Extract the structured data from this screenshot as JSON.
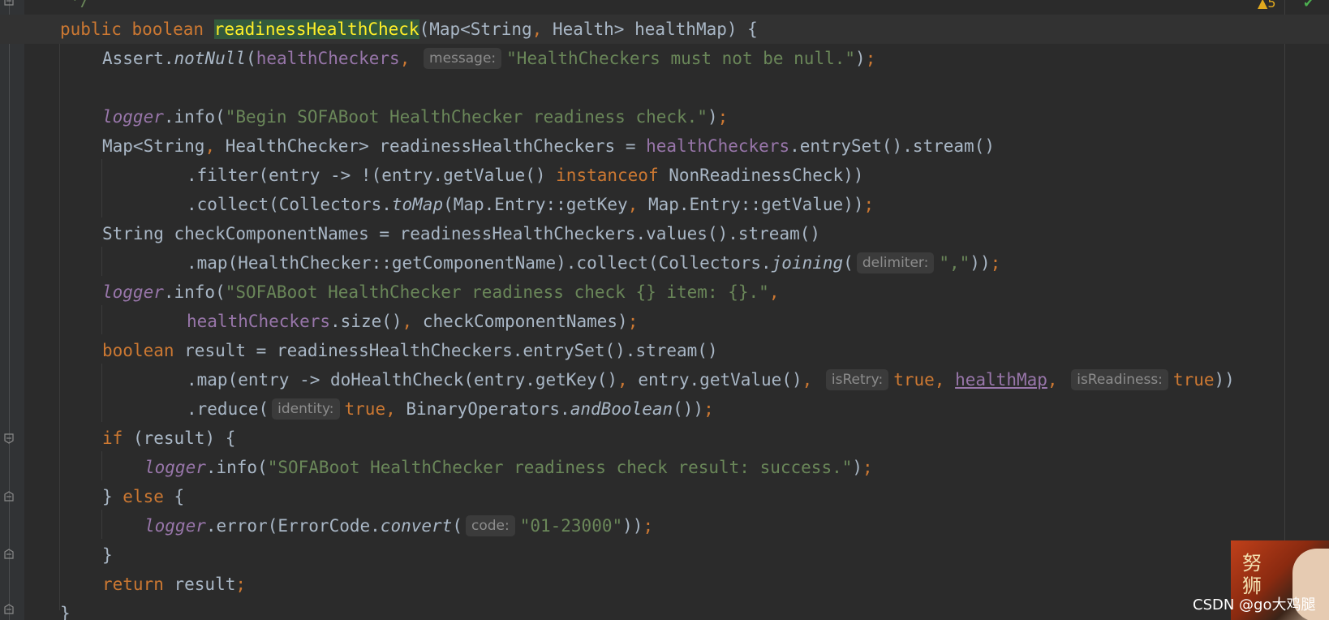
{
  "editor": {
    "top_comment": "*/",
    "warning_count": "5",
    "lines": {
      "l1": {
        "kw1": "public",
        "kw2": "boolean",
        "method": "readinessHealthCheck",
        "p1": "(Map<String",
        "c1": ",",
        "p2": " Health> healthMap) {"
      },
      "l2": {
        "a": "Assert.",
        "b": "notNull",
        "c": "(",
        "d": "healthCheckers",
        "e": ",",
        "hint": "message:",
        "s": "\"HealthCheckers must not be null.\"",
        "f": ")",
        "g": ";"
      },
      "l3": {
        "a": "logger",
        "b": ".info(",
        "s": "\"Begin SOFABoot HealthChecker readiness check.\"",
        "c": ")",
        "d": ";"
      },
      "l4": {
        "a": "Map<String",
        "b": ",",
        "c": " HealthChecker> readinessHealthCheckers = ",
        "d": "healthCheckers",
        "e": ".entrySet().stream()"
      },
      "l5": {
        "a": ".filter(entry -> !(entry.getValue() ",
        "kw": "instanceof",
        "b": " NonReadinessCheck))"
      },
      "l6": {
        "a": ".collect(Collectors.",
        "b": "toMap",
        "c": "(Map.Entry::getKey",
        "d": ",",
        "e": " Map.Entry::getValue))",
        "f": ";"
      },
      "l7": {
        "a": "String checkComponentNames = readinessHealthCheckers.values().stream()"
      },
      "l8": {
        "a": ".map(HealthChecker::getComponentName).collect(Collectors.",
        "b": "joining",
        "c": "(",
        "hint": "delimiter:",
        "s": "\",\"",
        "d": "))",
        "e": ";"
      },
      "l9": {
        "a": "logger",
        "b": ".info(",
        "s": "\"SOFABoot HealthChecker readiness check {} item: {}.\"",
        "c": ","
      },
      "l10": {
        "a": "healthCheckers",
        "b": ".size()",
        "c": ",",
        "d": " checkComponentNames)",
        "e": ";"
      },
      "l11": {
        "kw": "boolean",
        "a": " result = readinessHealthCheckers.entrySet().stream()"
      },
      "l12": {
        "a": ".map(entry -> doHealthCheck(entry.getKey()",
        "c1": ",",
        "b": " entry.getValue()",
        "c2": ",",
        "hint1": "isRetry:",
        "t1": "true",
        "c3": ",",
        "hm": "healthMap",
        "c4": ",",
        "hint2": "isReadiness:",
        "t2": "true",
        "e": "))"
      },
      "l13": {
        "a": ".reduce(",
        "hint": "identity:",
        "t": "true",
        "c": ",",
        "b": " BinaryOperators.",
        "m": "andBoolean",
        "d": "())",
        "e": ";"
      },
      "l14": {
        "kw": "if",
        "a": " (result) {"
      },
      "l15": {
        "a": "logger",
        "b": ".info(",
        "s": "\"SOFABoot HealthChecker readiness check result: success.\"",
        "c": ")",
        "d": ";"
      },
      "l16": {
        "a": "} ",
        "kw": "else",
        "b": " {"
      },
      "l17": {
        "a": "logger",
        "b": ".error(ErrorCode.",
        "m": "convert",
        "c": "(",
        "hint": "code:",
        "s": "\"01-23000\"",
        "d": "))",
        "e": ";"
      },
      "l18": {
        "a": "}"
      },
      "l19": {
        "kw": "return",
        "a": " result",
        "b": ";"
      },
      "l20": {
        "a": "}"
      }
    }
  },
  "overlay": {
    "watermark": "CSDN @go大鸡腿",
    "avatar_text": "努力\n狮子"
  },
  "colors": {
    "background": "#2b2b2b",
    "keyword": "#cc7832",
    "string": "#6a8759",
    "field": "#9876aa",
    "text": "#a9b7c6",
    "method_highlight": "#32593d"
  }
}
